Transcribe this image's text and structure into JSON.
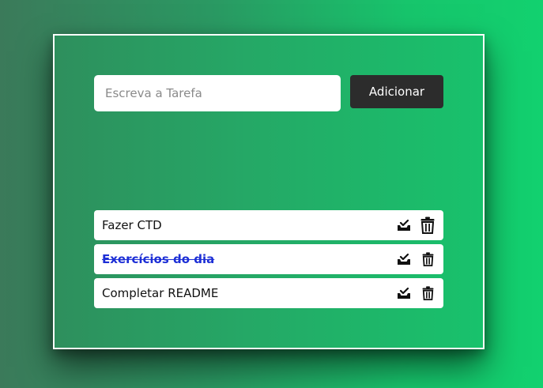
{
  "input": {
    "value": "",
    "placeholder": "Escreva a Tarefa"
  },
  "add_button": {
    "label": "Adicionar"
  },
  "tasks": [
    {
      "text": "Fazer CTD",
      "completed": false
    },
    {
      "text": "Exercícios do dia",
      "completed": true
    },
    {
      "text": "Completar README",
      "completed": false
    }
  ],
  "icons": {
    "complete": "inbox-check-icon",
    "delete": "trash-icon"
  },
  "colors": {
    "card_border": "#ffffff",
    "button_bg": "#2c2c2c",
    "completed_text": "#1d2fd6"
  }
}
